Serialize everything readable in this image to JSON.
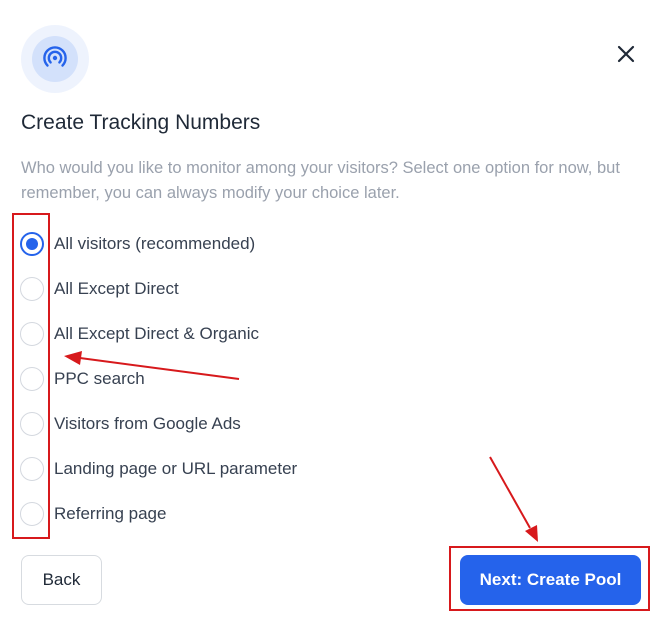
{
  "dialog": {
    "title": "Create Tracking Numbers",
    "description": "Who would you like to monitor among your visitors? Select one option for now, but remember, you can always modify your choice later.",
    "options": [
      {
        "label": "All visitors (recommended)",
        "selected": true
      },
      {
        "label": "All Except Direct",
        "selected": false
      },
      {
        "label": "All Except Direct & Organic",
        "selected": false
      },
      {
        "label": "PPC search",
        "selected": false
      },
      {
        "label": "Visitors from Google Ads",
        "selected": false
      },
      {
        "label": "Landing page or URL parameter",
        "selected": false
      },
      {
        "label": "Referring page",
        "selected": false
      }
    ],
    "back_label": "Back",
    "next_label": "Next: Create Pool"
  },
  "icons": {
    "header": "broadcast-signal-icon",
    "close": "close-icon"
  },
  "colors": {
    "accent": "#2563eb",
    "annotation": "#d7191c",
    "muted_text": "#9aa1ad"
  }
}
